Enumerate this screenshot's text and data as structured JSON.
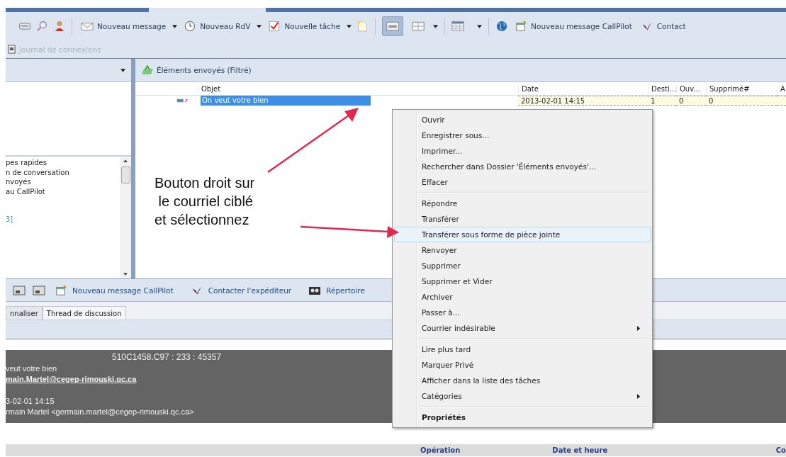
{
  "toolbar": {
    "new_message": {
      "label": "Nouveau message"
    },
    "new_appointment": {
      "label": "Nouveau RdV"
    },
    "new_task": {
      "label": "Nouvelle tâche"
    },
    "view_buttons": [
      {
        "selected": true
      },
      {
        "selected": false
      }
    ],
    "callpilot": {
      "label": "Nouveau message CallPilot"
    },
    "contact": {
      "label": "Contact"
    }
  },
  "secondary_toolbar": {
    "journal": {
      "label": "Journal de connexions",
      "disabled": true
    }
  },
  "folder_pane": {
    "items": [
      {
        "label": "pes rapides",
        "kind": "folder"
      },
      {
        "label": "n de conversation",
        "kind": "folder"
      },
      {
        "label": "nvoyés",
        "kind": "folder"
      },
      {
        "label": "au CallPilot",
        "kind": "folder"
      },
      {
        "label": "3]",
        "kind": "count"
      }
    ]
  },
  "message_list": {
    "title": "Éléments envoyés (Filtré)",
    "columns": [
      "Objet",
      "Date",
      "Desti...",
      "Ouv...",
      "Supprimé#",
      "A"
    ],
    "rows": [
      {
        "subject": "On veut votre bien",
        "date": "2013-02-01 14:15",
        "recipients": "1",
        "opened": "0",
        "deleted": "0",
        "selected": true
      }
    ]
  },
  "annotation": {
    "text": "Bouton droit sur\n le courriel ciblé\net sélectionnez"
  },
  "context_menu": {
    "groups": [
      [
        {
          "label": "Ouvrir",
          "selected": false,
          "submenu": false,
          "default": false
        },
        {
          "label": "Enregistrer sous...",
          "selected": false,
          "submenu": false,
          "default": false
        },
        {
          "label": "Imprimer...",
          "selected": false,
          "submenu": false,
          "default": false
        },
        {
          "label": "Rechercher dans Dossier 'Éléments envoyés'...",
          "selected": false,
          "submenu": false,
          "default": false
        },
        {
          "label": "Effacer",
          "selected": false,
          "submenu": false,
          "default": false
        }
      ],
      [
        {
          "label": "Répondre",
          "selected": false,
          "submenu": false,
          "default": false
        },
        {
          "label": "Transférer",
          "selected": false,
          "submenu": false,
          "default": false
        },
        {
          "label": "Transférer sous forme de pièce jointe",
          "selected": true,
          "submenu": false,
          "default": false
        },
        {
          "label": "Renvoyer",
          "selected": false,
          "submenu": false,
          "default": false
        },
        {
          "label": "Supprimer",
          "selected": false,
          "submenu": false,
          "default": false
        },
        {
          "label": "Supprimer et Vider",
          "selected": false,
          "submenu": false,
          "default": false
        },
        {
          "label": "Archiver",
          "selected": false,
          "submenu": false,
          "default": false
        },
        {
          "label": "Passer à...",
          "selected": false,
          "submenu": false,
          "default": false
        },
        {
          "label": "Courrier indésirable",
          "selected": false,
          "submenu": true,
          "default": false
        }
      ],
      [
        {
          "label": "Lire plus tard",
          "selected": false,
          "submenu": false,
          "default": false
        },
        {
          "label": "Marquer Privé",
          "selected": false,
          "submenu": false,
          "default": false
        },
        {
          "label": "Afficher dans la liste des tâches",
          "selected": false,
          "submenu": false,
          "default": false
        },
        {
          "label": "Catégories",
          "selected": false,
          "submenu": true,
          "default": false
        }
      ],
      [
        {
          "label": "Propriétés",
          "selected": false,
          "submenu": false,
          "default": true
        }
      ]
    ]
  },
  "reading_toolbar": {
    "items": [
      {
        "label": "Nouveau message CallPilot"
      },
      {
        "label": "Contacter l'expéditeur"
      },
      {
        "label": "Répertoire"
      }
    ]
  },
  "reading_tabs": [
    {
      "label": "nnaliser",
      "selected": false
    },
    {
      "label": "Thread de discussion",
      "selected": true
    }
  ],
  "message_header": {
    "id": "510C1458.C97 : 233 : 45357",
    "subject": "veut votre bien",
    "to": "main.Martel@cegep-rimouski.qc.ca",
    "date": "3-02-01 14:15",
    "from": "rmain Martel <germain.martel@cegep-rimouski.qc.ca>"
  },
  "log_table": {
    "columns": [
      "Opération",
      "Date et heure",
      "Co"
    ]
  }
}
